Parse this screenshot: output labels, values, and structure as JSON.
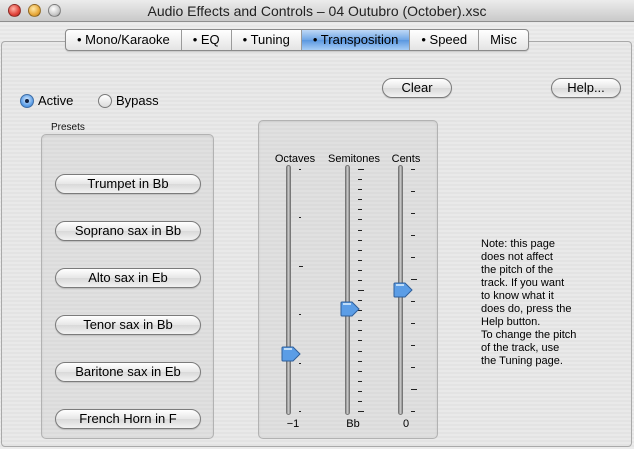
{
  "window": {
    "title": "Audio Effects and Controls – 04 Outubro (October).xsc"
  },
  "tabs": [
    {
      "label": "• Mono/Karaoke",
      "selected": false
    },
    {
      "label": "• EQ",
      "selected": false
    },
    {
      "label": "• Tuning",
      "selected": false
    },
    {
      "label": "• Transposition",
      "selected": true
    },
    {
      "label": "• Speed",
      "selected": false
    },
    {
      "label": "Misc",
      "selected": false
    }
  ],
  "mode": {
    "active_label": "Active",
    "bypass_label": "Bypass",
    "selected": "Active"
  },
  "buttons": {
    "clear": "Clear",
    "help": "Help..."
  },
  "presets": {
    "label": "Presets",
    "items": [
      "Trumpet in Bb",
      "Soprano sax in Bb",
      "Alto sax in Eb",
      "Tenor sax in Bb",
      "Baritone sax in Eb",
      "French Horn in F"
    ]
  },
  "sliders": {
    "octaves": {
      "label": "Octaves",
      "value_label": "−1",
      "position": 0.755
    },
    "semitones": {
      "label": "Semitones",
      "value_label": "Bb",
      "position": 0.574
    },
    "cents": {
      "label": "Cents",
      "value_label": "0",
      "position": 0.5
    }
  },
  "note": "Note: this page\ndoes not affect\nthe pitch of the\ntrack. If you want\nto know what it\ndoes do, press the\nHelp button.\nTo change the pitch\nof the track, use\nthe Tuning page.",
  "colors": {
    "tab_selected": "#6fa6e6",
    "thumb": "#5b9de6"
  }
}
